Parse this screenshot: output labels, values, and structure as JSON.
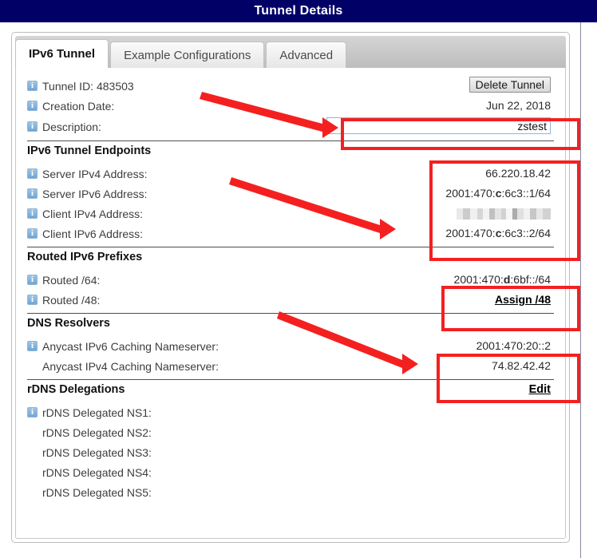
{
  "window": {
    "title": "Tunnel Details"
  },
  "tabs": [
    {
      "label": "IPv6 Tunnel",
      "active": true
    },
    {
      "label": "Example Configurations",
      "active": false
    },
    {
      "label": "Advanced",
      "active": false
    }
  ],
  "general": {
    "tunnel_id_label": "Tunnel ID: 483503",
    "delete_button": "Delete Tunnel",
    "creation_date_label": "Creation Date:",
    "creation_date_value": "Jun 22, 2018",
    "description_label": "Description:",
    "description_value": "zstest",
    "description_placeholder": ""
  },
  "endpoints": {
    "heading": "IPv6 Tunnel Endpoints",
    "rows": [
      {
        "label": "Server IPv4 Address:",
        "value": "66.220.18.42",
        "bold_part": "",
        "icon": true,
        "redacted": false
      },
      {
        "label": "Server IPv6 Address:",
        "value": "2001:470:c:6c3::1/64",
        "bold_part": "c",
        "icon": true,
        "redacted": false
      },
      {
        "label": "Client IPv4 Address:",
        "value": "",
        "bold_part": "",
        "icon": true,
        "redacted": true
      },
      {
        "label": "Client IPv6 Address:",
        "value": "2001:470:c:6c3::2/64",
        "bold_part": "c",
        "icon": true,
        "redacted": false
      }
    ]
  },
  "routed": {
    "heading": "Routed IPv6 Prefixes",
    "rows": [
      {
        "label": "Routed /64:",
        "value": "2001:470:d:6bf::/64",
        "bold_part": "d",
        "icon": true,
        "link": false
      },
      {
        "label": "Routed /48:",
        "value": "Assign /48",
        "bold_part": "",
        "icon": true,
        "link": true
      }
    ]
  },
  "dns": {
    "heading": "DNS Resolvers",
    "rows": [
      {
        "label": "Anycast IPv6 Caching Nameserver:",
        "value": "2001:470:20::2",
        "icon": true
      },
      {
        "label": "Anycast IPv4 Caching Nameserver:",
        "value": "74.82.42.42",
        "icon": false
      }
    ]
  },
  "rdns": {
    "heading": "rDNS Delegations",
    "edit_link": "Edit",
    "rows": [
      {
        "label": "rDNS Delegated NS1:",
        "value": "",
        "icon": true
      },
      {
        "label": "rDNS Delegated NS2:",
        "value": "",
        "icon": false
      },
      {
        "label": "rDNS Delegated NS3:",
        "value": "",
        "icon": false
      },
      {
        "label": "rDNS Delegated NS4:",
        "value": "",
        "icon": false
      },
      {
        "label": "rDNS Delegated NS5:",
        "value": "",
        "icon": false
      }
    ]
  },
  "colors": {
    "titlebar_bg": "#000066",
    "annotation_red": "#f42020",
    "input_border": "#8cb4e8"
  }
}
